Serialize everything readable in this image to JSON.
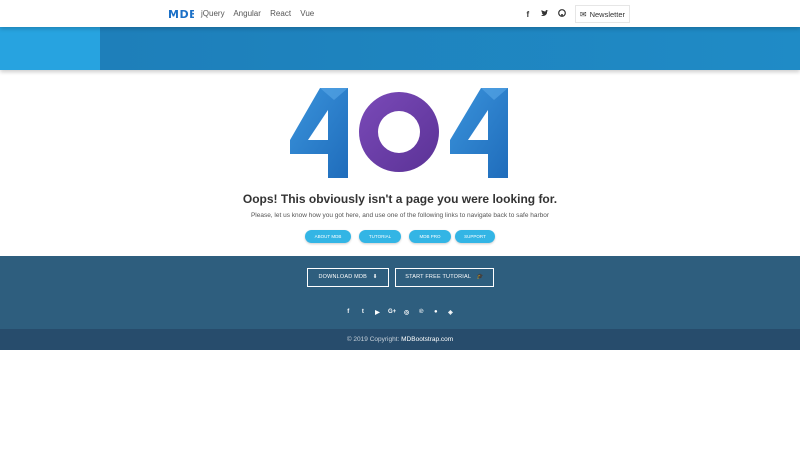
{
  "navbar": {
    "brand": "MDB",
    "links": [
      "jQuery",
      "Angular",
      "React",
      "Vue"
    ],
    "social_icons": [
      "facebook-icon",
      "twitter-icon",
      "github-icon"
    ],
    "newsletter_label": "Newsletter"
  },
  "error": {
    "code": "404",
    "title": "Oops! This obviously isn't a page you were looking for.",
    "subtitle": "Please, let us know how you got here, and use one of the following links to navigate back to safe harbor",
    "links": [
      "ABOUT MDB",
      "TUTORIAL",
      "MDB PRO",
      "SUPPORT"
    ]
  },
  "footer": {
    "download_label": "DOWNLOAD MDB",
    "tutorial_label": "START FREE TUTORIAL",
    "social_icons": [
      "facebook-icon",
      "twitter-icon",
      "youtube-icon",
      "google-plus-icon",
      "dribbble-icon",
      "pinterest-icon",
      "github-icon",
      "codepen-icon"
    ],
    "copyright_prefix": "© 2019 Copyright:",
    "copyright_link": "MDBootstrap.com"
  },
  "colors": {
    "hero": "#1F8BC6",
    "hero_accent": "#27A3E0",
    "pill": "#33B5E5",
    "footer": "#2E5E7E",
    "copyright": "#274C6C",
    "digit_blue": "#2F7EC9",
    "zero_purple": "#6C3FA6"
  }
}
